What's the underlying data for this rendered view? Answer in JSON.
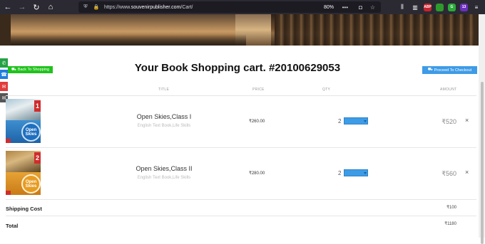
{
  "browser": {
    "url_prefix": "https://www.",
    "url_domain": "souvenirpublisher.com",
    "url_path": "/Cart/",
    "zoom": "80%",
    "ext_badges": [
      {
        "label": "ABP",
        "color": "#c8232c"
      },
      {
        "label": "",
        "color": "#2f9a2c"
      },
      {
        "label": "G",
        "color": "#2bab3a"
      },
      {
        "label": "13",
        "color": "#6b2fbd"
      }
    ]
  },
  "page": {
    "back_label": "Back To Shopping",
    "checkout_label": "Proceed To Checkout",
    "title": "Your Book Shopping cart. #20100629053"
  },
  "table": {
    "headers": [
      "TITLE",
      "PRICE",
      "QTY",
      "AMOUNT"
    ]
  },
  "items": [
    {
      "name": "Open Skies,Class I",
      "subtitle": "English Text Book,Life Skills",
      "price": "₹260.00",
      "qty": "2",
      "amount": "₹520",
      "cover_num": "1",
      "cover_text": "Open Skies"
    },
    {
      "name": "Open Skies,Class II",
      "subtitle": "English Text Book,Life Skills",
      "price": "₹280.00",
      "qty": "2",
      "amount": "₹560",
      "cover_num": "2",
      "cover_text": "Open Skies"
    }
  ],
  "summary": {
    "shipping_label": "Shipping Cost",
    "shipping_value": "₹100",
    "total_label": "Total",
    "total_value": "₹1180"
  },
  "icons": {
    "remove": "×"
  }
}
